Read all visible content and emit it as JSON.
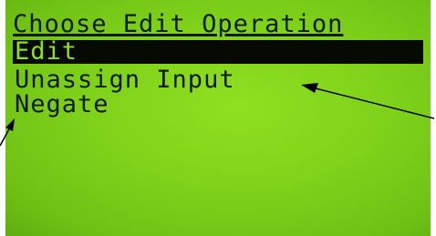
{
  "screen": {
    "title": "Choose Edit Operation",
    "menu": [
      {
        "label": "Edit",
        "selected": true
      },
      {
        "label": "Unassign Input",
        "selected": false
      },
      {
        "label": "Negate",
        "selected": false
      }
    ]
  },
  "colors": {
    "lcd_background": "#7fd21a",
    "lcd_text": "#0e1a02",
    "selection_background": "#060a02",
    "annotation_arrow": "#000000"
  }
}
